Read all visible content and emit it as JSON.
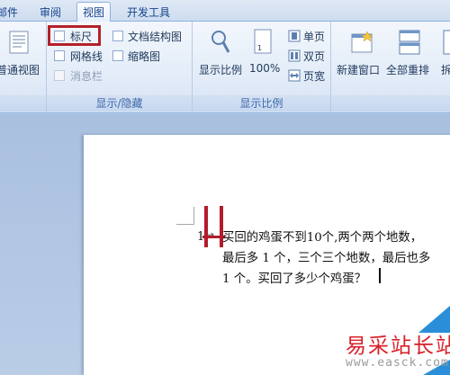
{
  "tabs": [
    {
      "label": "邮件"
    },
    {
      "label": "审阅"
    },
    {
      "label": "视图"
    },
    {
      "label": "开发工具"
    }
  ],
  "ribbon": {
    "views_group": {
      "print_view": "普通视图"
    },
    "show_hide": {
      "ruler": "标尺",
      "gridlines": "网格线",
      "message_bar": "消息栏",
      "doc_map": "文档结构图",
      "thumbnails": "缩略图",
      "label": "显示/隐藏"
    },
    "zoom": {
      "zoom": "显示比例",
      "hundred": "100%",
      "one_page": "单页",
      "two_pages": "双页",
      "page_width": "页宽",
      "label": "显示比例"
    },
    "window": {
      "new_window": "新建窗口",
      "arrange_all": "全部重排",
      "split": "拆"
    }
  },
  "document": {
    "list_number": "1",
    "lines": [
      "买回的鸡蛋不到10个,两个两个地数，",
      "最后多 1 个，三个三个地数，最后也多",
      "1 个。买回了多少个鸡蛋？"
    ]
  },
  "watermark": {
    "site": "易采站长站",
    "url": "www.easck.com"
  }
}
